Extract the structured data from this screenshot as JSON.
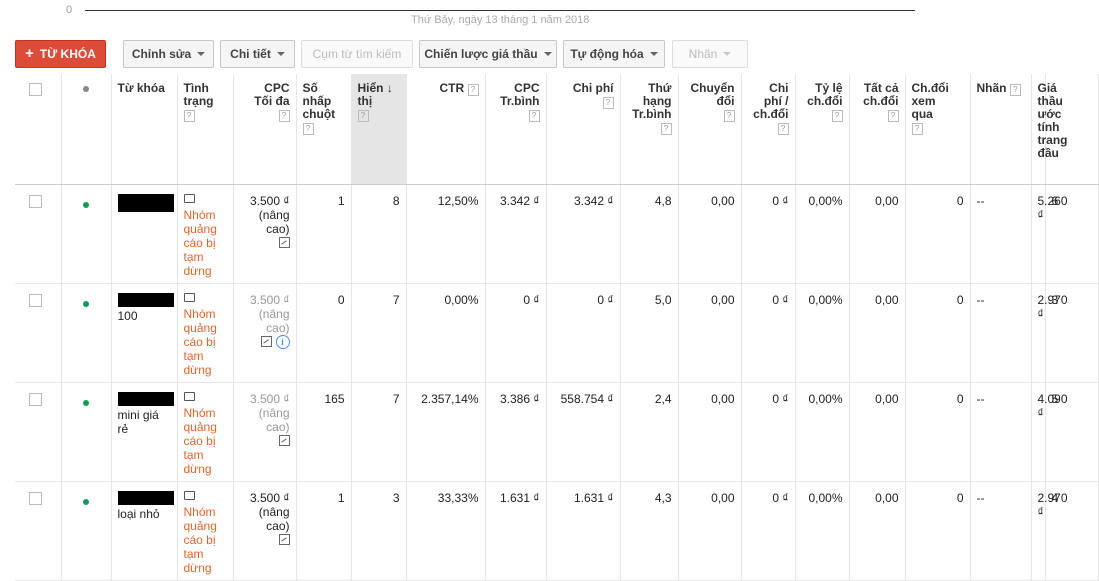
{
  "chart": {
    "zero_label": "0",
    "date_label": "Thứ Bảy, ngày 13 tháng 1 năm 2018"
  },
  "toolbar": {
    "add_keyword": "TỪ KHÓA",
    "edit": "Chỉnh sửa",
    "details": "Chi tiết",
    "search_terms": "Cụm từ tìm kiếm",
    "bid_strategy": "Chiến lược giá thầu",
    "automate": "Tự động hóa",
    "labels": "Nhãn"
  },
  "headers": {
    "keyword": "Từ khóa",
    "status": [
      "Tình",
      "trạng"
    ],
    "max_cpc": [
      "CPC",
      "Tối đa"
    ],
    "clicks": [
      "Số",
      "nhấp",
      "chuột"
    ],
    "impressions": [
      "Hiển",
      "thị"
    ],
    "ctr": "CTR",
    "avg_cpc": [
      "CPC",
      "Tr.bình"
    ],
    "cost": "Chi phí",
    "avg_pos": [
      "Thứ",
      "hạng",
      "Tr.bình"
    ],
    "conversions": [
      "Chuyển",
      "đổi"
    ],
    "cost_per_conv": [
      "Chi",
      "phí /",
      "ch.đổi"
    ],
    "conv_rate": [
      "Tỷ lệ",
      "ch.đổi"
    ],
    "all_conv": [
      "Tất cả",
      "ch.đổi"
    ],
    "view_through": [
      "Ch.đổi",
      "xem",
      "qua"
    ],
    "labels": "Nhãn",
    "first_page_bid": [
      "Giá",
      "thầu",
      "ước",
      "tính",
      "trang",
      "đầu"
    ],
    "help": "?",
    "sort_arrow": "↓"
  },
  "rows": [
    {
      "keyword_visible": "",
      "status": [
        "Nhóm",
        "quảng",
        "cáo bị",
        "tạm",
        "dừng"
      ],
      "cpc": [
        "3.500 ₫",
        "(nâng",
        "cao)"
      ],
      "cpc_dim": false,
      "info": false,
      "clicks": "1",
      "impressions": "8",
      "ctr": "12,50%",
      "avg_cpc": "3.342 ₫",
      "cost": "3.342 ₫",
      "avg_pos": "4,8",
      "conversions": "0,00",
      "cost_per_conv": "0 ₫",
      "conv_rate": "0,00%",
      "all_conv": "0,00",
      "view_through": "0",
      "labels": "--",
      "first_page_bid": "5.260 ₫",
      "overflow": "6"
    },
    {
      "keyword_visible": "100",
      "status": [
        "Nhóm",
        "quảng",
        "cáo bị",
        "tạm",
        "dừng"
      ],
      "cpc": [
        "3.500 ₫",
        "(nâng",
        "cao)"
      ],
      "cpc_dim": true,
      "info": true,
      "info_glyph": "i",
      "clicks": "0",
      "impressions": "7",
      "ctr": "0,00%",
      "avg_cpc": "0 ₫",
      "cost": "0 ₫",
      "avg_pos": "5,0",
      "conversions": "0,00",
      "cost_per_conv": "0 ₫",
      "conv_rate": "0,00%",
      "all_conv": "0,00",
      "view_through": "0",
      "labels": "--",
      "first_page_bid": "2.970 ₫",
      "overflow": "3"
    },
    {
      "keyword_visible": "mini giá rẻ",
      "status": [
        "Nhóm",
        "quảng",
        "cáo bị",
        "tạm",
        "dừng"
      ],
      "cpc": [
        "3.500 ₫",
        "(nâng",
        "cao)"
      ],
      "cpc_dim": true,
      "info": false,
      "clicks": "165",
      "impressions": "7",
      "ctr": "2.357,14%",
      "avg_cpc": "3.386 ₫",
      "cost": "558.754 ₫",
      "avg_pos": "2,4",
      "conversions": "0,00",
      "cost_per_conv": "0 ₫",
      "conv_rate": "0,00%",
      "all_conv": "0,00",
      "view_through": "0",
      "labels": "--",
      "first_page_bid": "4.090 ₫",
      "overflow": "5"
    },
    {
      "keyword_visible": "loại nhỏ",
      "status": [
        "Nhóm",
        "quảng",
        "cáo bị",
        "tạm",
        "dừng"
      ],
      "cpc": [
        "3.500 ₫",
        "(nâng",
        "cao)"
      ],
      "cpc_dim": false,
      "info": false,
      "clicks": "1",
      "impressions": "3",
      "ctr": "33,33%",
      "avg_cpc": "1.631 ₫",
      "cost": "1.631 ₫",
      "avg_pos": "4,3",
      "conversions": "0,00",
      "cost_per_conv": "0 ₫",
      "conv_rate": "0,00%",
      "all_conv": "0,00",
      "view_through": "0",
      "labels": "--",
      "first_page_bid": "2.970 ₫",
      "overflow": "4"
    }
  ],
  "icons": {
    "status_icon": "speech-bubble-icon",
    "cpc_icon": "bid-chart-icon",
    "dot_color": "#0f9d58",
    "status_color": "#e0662a",
    "primary_color": "#dd4b39"
  }
}
